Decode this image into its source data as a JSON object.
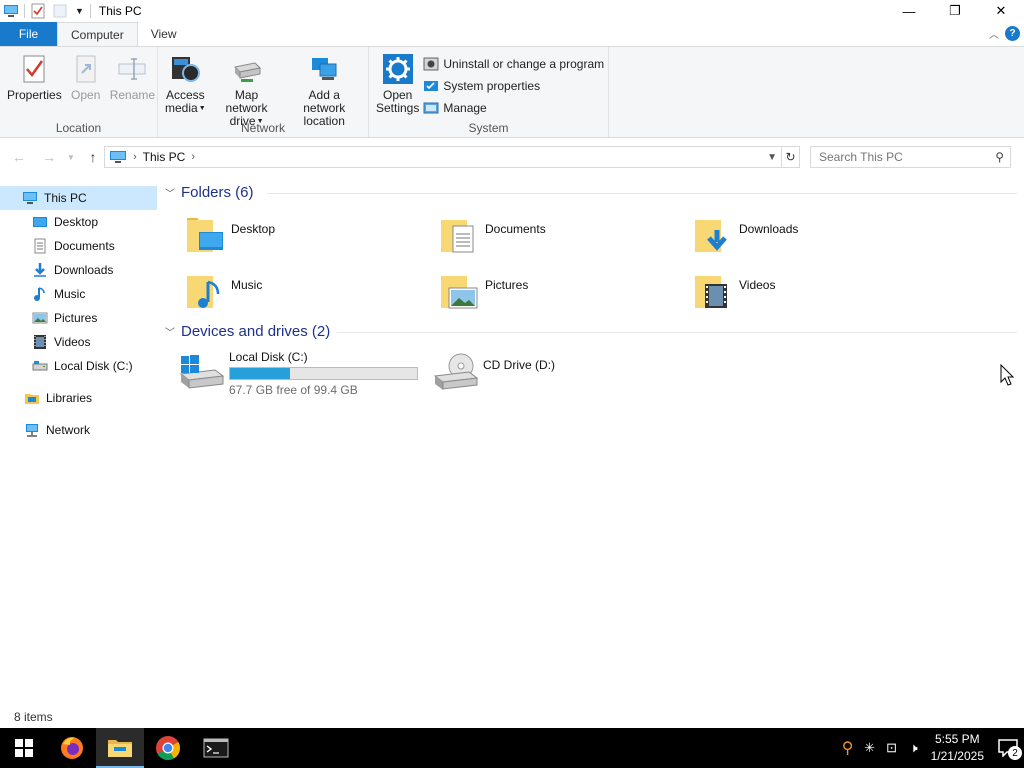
{
  "window": {
    "title": "This PC",
    "controls": {
      "minimize": "—",
      "maximize": "❐",
      "close": "✕"
    }
  },
  "ribbon": {
    "tabs": [
      {
        "label": "File"
      },
      {
        "label": "Computer"
      },
      {
        "label": "View"
      }
    ],
    "help": "?",
    "groups": {
      "location": {
        "label": "Location",
        "properties": "Properties",
        "open": "Open",
        "rename": "Rename"
      },
      "network": {
        "label": "Network",
        "access_media_1": "Access",
        "access_media_2": "media",
        "map_drive_1": "Map network",
        "map_drive_2": "drive",
        "add_location_1": "Add a network",
        "add_location_2": "location"
      },
      "system": {
        "label": "System",
        "open_settings_1": "Open",
        "open_settings_2": "Settings",
        "uninstall": "Uninstall or change a program",
        "system_properties": "System properties",
        "manage": "Manage"
      }
    }
  },
  "address": {
    "crumb": "This PC",
    "search_placeholder": "Search This PC"
  },
  "nav": {
    "this_pc": "This PC",
    "items": [
      {
        "label": "Desktop",
        "icon": "desktop-icon"
      },
      {
        "label": "Documents",
        "icon": "documents-icon"
      },
      {
        "label": "Downloads",
        "icon": "downloads-icon"
      },
      {
        "label": "Music",
        "icon": "music-icon"
      },
      {
        "label": "Pictures",
        "icon": "pictures-icon"
      },
      {
        "label": "Videos",
        "icon": "videos-icon"
      },
      {
        "label": "Local Disk (C:)",
        "icon": "drive-icon"
      }
    ],
    "libraries": "Libraries",
    "network": "Network"
  },
  "main": {
    "folders_header": "Folders (6)",
    "folders": [
      {
        "label": "Desktop"
      },
      {
        "label": "Documents"
      },
      {
        "label": "Downloads"
      },
      {
        "label": "Music"
      },
      {
        "label": "Pictures"
      },
      {
        "label": "Videos"
      }
    ],
    "drives_header": "Devices and drives (2)",
    "drives": [
      {
        "label": "Local Disk (C:)",
        "free_text": "67.7 GB free of 99.4 GB",
        "used_fraction": 0.319
      },
      {
        "label": "CD Drive (D:)"
      }
    ]
  },
  "status": {
    "items": "8 items"
  },
  "taskbar": {
    "time": "5:55 PM",
    "date": "1/21/2025",
    "notifications": "2"
  },
  "colors": {
    "accent": "#1979ca",
    "selection": "#cce8ff",
    "drive_fill": "#26a0da",
    "folder_yellow": "#f8d775",
    "group_header": "#1e3287"
  }
}
